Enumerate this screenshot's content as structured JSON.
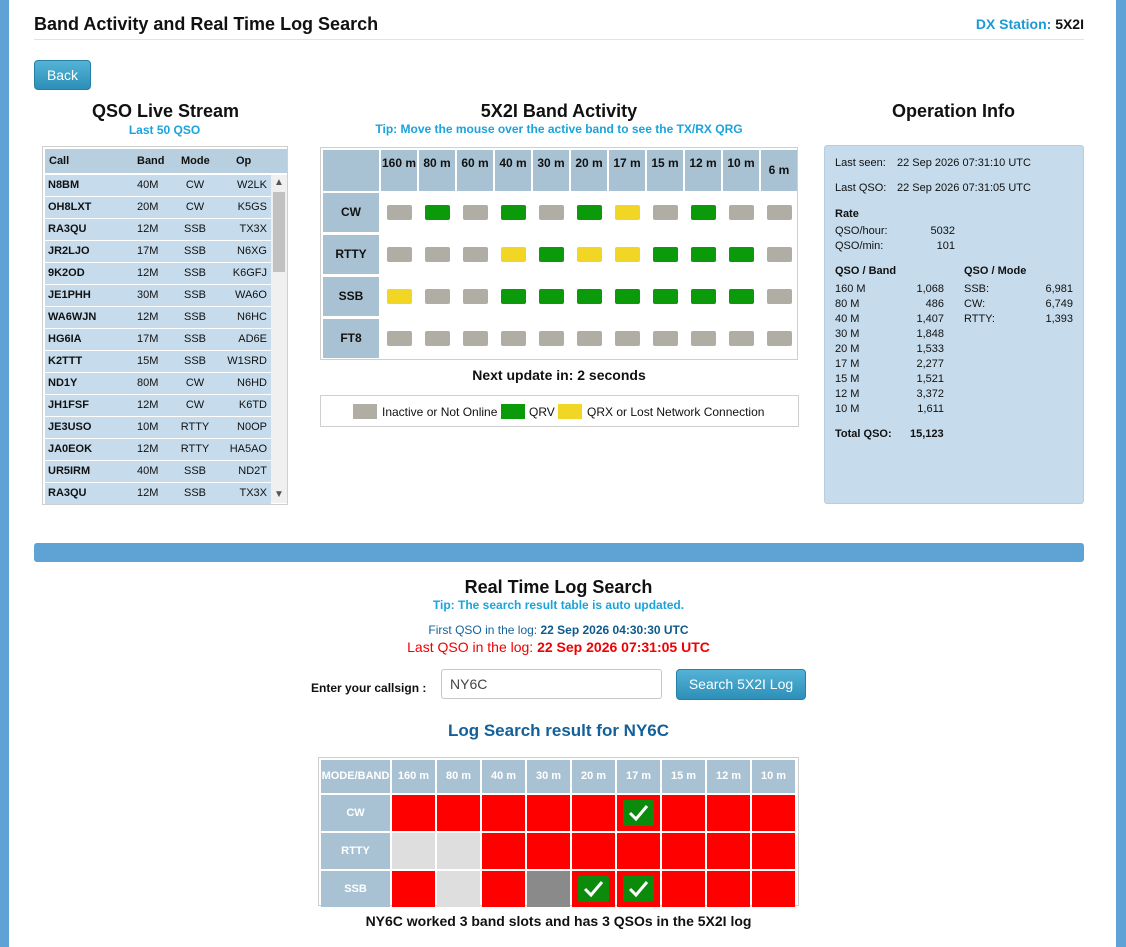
{
  "header": {
    "title": "Band Activity and Real Time Log Search",
    "dx_label": "DX Station:",
    "dx_call": "5X2I"
  },
  "back_label": "Back",
  "live_stream": {
    "title": "QSO Live Stream",
    "subtitle": "Last 50 QSO",
    "columns": [
      "Call",
      "Band",
      "Mode",
      "Op"
    ],
    "rows": [
      {
        "call": "N8BM",
        "band": "40M",
        "mode": "CW",
        "op": "W2LK"
      },
      {
        "call": "OH8LXT",
        "band": "20M",
        "mode": "CW",
        "op": "K5GS"
      },
      {
        "call": "RA3QU",
        "band": "12M",
        "mode": "SSB",
        "op": "TX3X"
      },
      {
        "call": "JR2LJO",
        "band": "17M",
        "mode": "SSB",
        "op": "N6XG"
      },
      {
        "call": "9K2OD",
        "band": "12M",
        "mode": "SSB",
        "op": "K6GFJ"
      },
      {
        "call": "JE1PHH",
        "band": "30M",
        "mode": "SSB",
        "op": "WA6O"
      },
      {
        "call": "WA6WJN",
        "band": "12M",
        "mode": "SSB",
        "op": "N6HC"
      },
      {
        "call": "HG6IA",
        "band": "17M",
        "mode": "SSB",
        "op": "AD6E"
      },
      {
        "call": "K2TTT",
        "band": "15M",
        "mode": "SSB",
        "op": "W1SRD"
      },
      {
        "call": "ND1Y",
        "band": "80M",
        "mode": "CW",
        "op": "N6HD"
      },
      {
        "call": "JH1FSF",
        "band": "12M",
        "mode": "CW",
        "op": "K6TD"
      },
      {
        "call": "JE3USO",
        "band": "10M",
        "mode": "RTTY",
        "op": "N0OP"
      },
      {
        "call": "JA0EOK",
        "band": "12M",
        "mode": "RTTY",
        "op": "HA5AO"
      },
      {
        "call": "UR5IRM",
        "band": "40M",
        "mode": "SSB",
        "op": "ND2T"
      },
      {
        "call": "RA3QU",
        "band": "12M",
        "mode": "SSB",
        "op": "TX3X"
      }
    ]
  },
  "band_activity": {
    "title": "5X2I Band Activity",
    "tip": "Tip: Move the mouse over the active band to see the TX/RX QRG",
    "bands": [
      "160 m",
      "80 m",
      "60 m",
      "40 m",
      "30 m",
      "20 m",
      "17 m",
      "15 m",
      "12 m",
      "10 m",
      "6 m"
    ],
    "modes": [
      {
        "name": "CW",
        "states": [
          "off",
          "qrv",
          "off",
          "qrv",
          "off",
          "qrv",
          "qrx",
          "off",
          "qrv",
          "off",
          "off"
        ]
      },
      {
        "name": "RTTY",
        "states": [
          "off",
          "off",
          "off",
          "qrx",
          "qrv",
          "qrx",
          "qrx",
          "qrv",
          "qrv",
          "qrv",
          "off"
        ]
      },
      {
        "name": "SSB",
        "states": [
          "qrx",
          "off",
          "off",
          "qrv",
          "qrv",
          "qrv",
          "qrv",
          "qrv",
          "qrv",
          "qrv",
          "off"
        ]
      },
      {
        "name": "FT8",
        "states": [
          "off",
          "off",
          "off",
          "off",
          "off",
          "off",
          "off",
          "off",
          "off",
          "off",
          "off"
        ]
      }
    ],
    "next_update": "Next update in: 2 seconds",
    "legend": [
      {
        "label": "Inactive or Not Online",
        "color": "#b0aea4"
      },
      {
        "label": "QRV",
        "color": "#0a9a0a"
      },
      {
        "label": "QRX or Lost Network Connection",
        "color": "#f2d626"
      }
    ]
  },
  "operation_info": {
    "title": "Operation Info",
    "last_seen_label": "Last seen:",
    "last_seen": "22 Sep 2026 07:31:10 UTC",
    "last_qso_label": "Last QSO:",
    "last_qso": "22 Sep 2026 07:31:05 UTC",
    "rate_label": "Rate",
    "qso_hour_label": "QSO/hour:",
    "qso_hour": "5032",
    "qso_min_label": "QSO/min:",
    "qso_min": "101",
    "band_title": "QSO / Band",
    "bands": [
      {
        "band": "160 M",
        "count": "1,068"
      },
      {
        "band": "80 M",
        "count": "486"
      },
      {
        "band": "40 M",
        "count": "1,407"
      },
      {
        "band": "30 M",
        "count": "1,848"
      },
      {
        "band": "20 M",
        "count": "1,533"
      },
      {
        "band": "17 M",
        "count": "2,277"
      },
      {
        "band": "15 M",
        "count": "1,521"
      },
      {
        "band": "12 M",
        "count": "3,372"
      },
      {
        "band": "10 M",
        "count": "1,611"
      }
    ],
    "mode_title": "QSO / Mode",
    "modes": [
      {
        "mode": "SSB:",
        "count": "6,981"
      },
      {
        "mode": "CW:",
        "count": "6,749"
      },
      {
        "mode": "RTTY:",
        "count": "1,393"
      }
    ],
    "total_label": "Total QSO:",
    "total": "15,123"
  },
  "log_search": {
    "title": "Real Time Log Search",
    "tip": "Tip: The search result table is auto updated.",
    "first_qso_label": "First QSO in the log:",
    "first_qso": "22 Sep 2026 04:30:30 UTC",
    "last_qso_label": "Last QSO in the log:",
    "last_qso": "22 Sep 2026 07:31:05 UTC",
    "callsign_label": "Enter your callsign :",
    "callsign_value": "NY6C",
    "search_button": "Search 5X2I Log",
    "result_title": "Log Search result for NY6C",
    "corner": "MODE/BAND",
    "bands": [
      "160 m",
      "80 m",
      "40 m",
      "30 m",
      "20 m",
      "17 m",
      "15 m",
      "12 m",
      "10 m"
    ],
    "rows": [
      {
        "mode": "CW",
        "cells": [
          "no",
          "no",
          "no",
          "no",
          "no",
          "ok",
          "no",
          "no",
          "no"
        ]
      },
      {
        "mode": "RTTY",
        "cells": [
          "na",
          "na",
          "no",
          "no",
          "no",
          "no",
          "no",
          "no",
          "no"
        ]
      },
      {
        "mode": "SSB",
        "cells": [
          "no",
          "na",
          "no",
          "pend",
          "ok",
          "ok",
          "no",
          "no",
          "no"
        ]
      }
    ],
    "summary": "NY6C worked 3 band slots and has 3 QSOs in the 5X2I log"
  }
}
